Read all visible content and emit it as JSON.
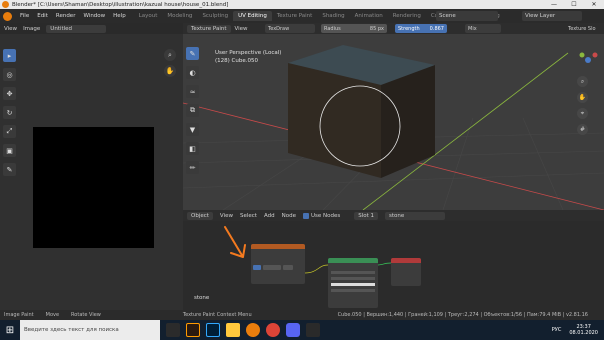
{
  "window": {
    "title": "Blender* [C:\\Users\\Shaman\\Desktop\\illustration\\kazual house\\house_01.blend]",
    "controls": [
      "—",
      "☐",
      "✕"
    ]
  },
  "menubar": {
    "items": [
      "File",
      "Edit",
      "Render",
      "Window",
      "Help"
    ],
    "tabs": [
      "Layout",
      "Modeling",
      "Sculpting",
      "UV Editing",
      "Texture Paint",
      "Shading",
      "Animation",
      "Rendering",
      "Compositing",
      "Scripting"
    ],
    "active_tab": "UV Editing",
    "scene": "Scene",
    "view_layer": "View Layer"
  },
  "image_editor": {
    "header": [
      "View",
      "Image"
    ],
    "image_name": "Untitled"
  },
  "viewport": {
    "mode": "Texture Paint",
    "view": "View",
    "brush": "TexDraw",
    "radius_label": "Radius",
    "radius_value": "85 px",
    "strength_label": "Strength",
    "strength_value": "0.867",
    "blend": "Mix",
    "texture_slots": "Texture Slo",
    "info_line1": "User Perspective (Local)",
    "info_line2": "(128) Cube.050"
  },
  "node_editor": {
    "object": "Object",
    "menu": [
      "View",
      "Select",
      "Add",
      "Node"
    ],
    "use_nodes": "Use Nodes",
    "slot": "Slot 1",
    "material": "stone",
    "material_label": "stone"
  },
  "statusbar": {
    "left": [
      "Image Paint",
      "Move",
      "Rotate View"
    ],
    "middle": "Texture Paint Context Menu",
    "stats": "Cube.050 | Вершин:1,440 | Граней:1,109 | Треуг:2,274 | Объектов:1/56 | Пам:79.4 MiB | v2.81.16"
  },
  "taskbar": {
    "search_placeholder": "Введите здесь текст для поиска",
    "lang": "РУС",
    "time": "23:37",
    "date": "08.01.2020"
  },
  "colors": {
    "accent": "#4772b3",
    "blender_orange": "#e87d0d",
    "annotation_orange": "#f47a1f",
    "node_output": "#b03a3a",
    "node_bsdf": "#3a8f55",
    "node_texture": "#b25a22"
  }
}
